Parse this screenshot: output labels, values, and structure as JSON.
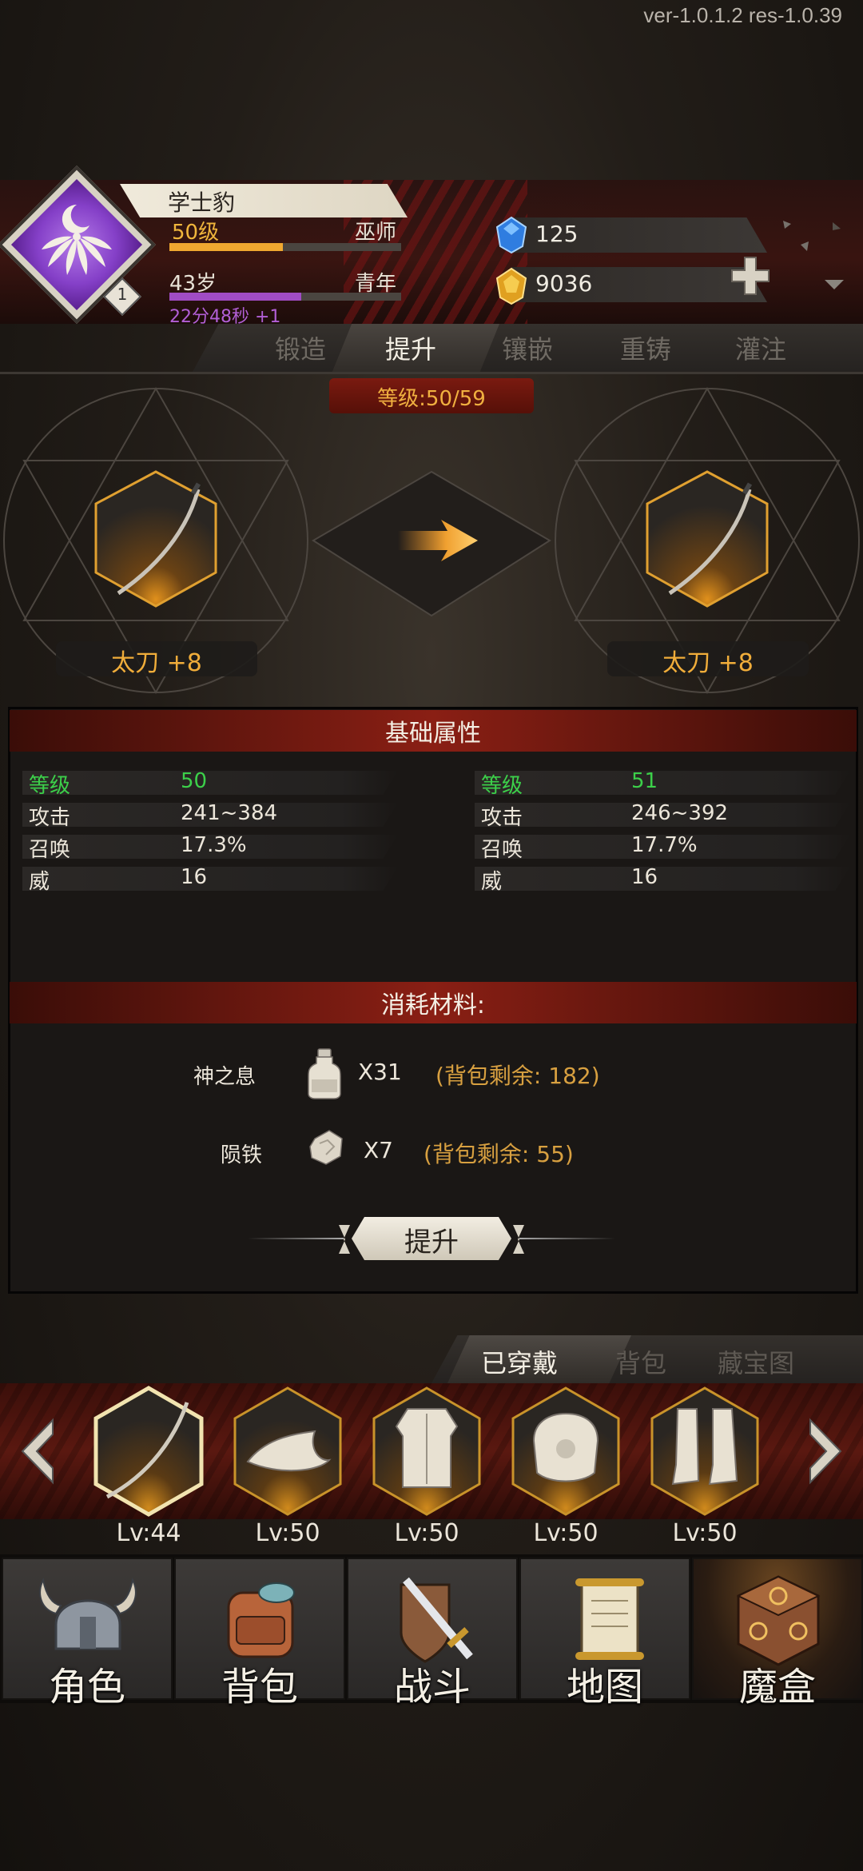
{
  "version": "ver-1.0.1.2  res-1.0.39",
  "character": {
    "name": "学士豹",
    "level_text": "50级",
    "class": "巫师",
    "level_progress": 0.49,
    "age_text": "43岁",
    "stage": "青年",
    "age_progress": 0.57,
    "timer": "22分48秒 +1",
    "badge_number": "1"
  },
  "currency": {
    "gems": "125",
    "gold": "9036"
  },
  "forge_tabs": [
    {
      "label": "锻造",
      "active": false
    },
    {
      "label": "提升",
      "active": true
    },
    {
      "label": "镶嵌",
      "active": false
    },
    {
      "label": "重铸",
      "active": false
    },
    {
      "label": "灌注",
      "active": false
    }
  ],
  "upgrade": {
    "level_indicator": "等级:50/59",
    "current_item": "太刀 +8",
    "next_item": "太刀 +8"
  },
  "stats": {
    "title": "基础属性",
    "current": [
      {
        "label": "等级",
        "value": "50"
      },
      {
        "label": "攻击",
        "value": "241~384"
      },
      {
        "label": "召唤",
        "value": "17.3%"
      },
      {
        "label": "威",
        "value": "16"
      }
    ],
    "next": [
      {
        "label": "等级",
        "value": "51"
      },
      {
        "label": "攻击",
        "value": "246~392"
      },
      {
        "label": "召唤",
        "value": "17.7%"
      },
      {
        "label": "威",
        "value": "16"
      }
    ]
  },
  "materials": {
    "title": "消耗材料:",
    "items": [
      {
        "name": "神之息",
        "icon": "potion-bottle-icon",
        "qty": "X31",
        "remaining": "(背包剩余: 182)"
      },
      {
        "name": "陨铁",
        "icon": "ore-icon",
        "qty": "X7",
        "remaining": "(背包剩余: 55)"
      }
    ]
  },
  "upgrade_button": "提升",
  "equip_tabs": [
    {
      "label": "已穿戴",
      "active": true
    },
    {
      "label": "背包",
      "active": false
    },
    {
      "label": "藏宝图",
      "active": false
    }
  ],
  "equipment": [
    {
      "icon": "katana-icon",
      "level": "Lv:44",
      "selected": true
    },
    {
      "icon": "wizard-hat-icon",
      "level": "Lv:50",
      "selected": false
    },
    {
      "icon": "armor-icon",
      "level": "Lv:50",
      "selected": false
    },
    {
      "icon": "gauntlet-icon",
      "level": "Lv:50",
      "selected": false
    },
    {
      "icon": "boots-icon",
      "level": "Lv:50",
      "selected": false
    }
  ],
  "nav": [
    {
      "label": "角色",
      "icon": "helmet-icon",
      "active": false
    },
    {
      "label": "背包",
      "icon": "backpack-icon",
      "active": false
    },
    {
      "label": "战斗",
      "icon": "sword-shield-icon",
      "active": false
    },
    {
      "label": "地图",
      "icon": "scroll-map-icon",
      "active": false
    },
    {
      "label": "魔盒",
      "icon": "magic-box-icon",
      "active": true
    }
  ],
  "colors": {
    "accent_gold": "#f0ad3a",
    "stat_green": "#3cd04a",
    "panel_red": "#8a1f14",
    "age_purple": "#a04cc4"
  }
}
